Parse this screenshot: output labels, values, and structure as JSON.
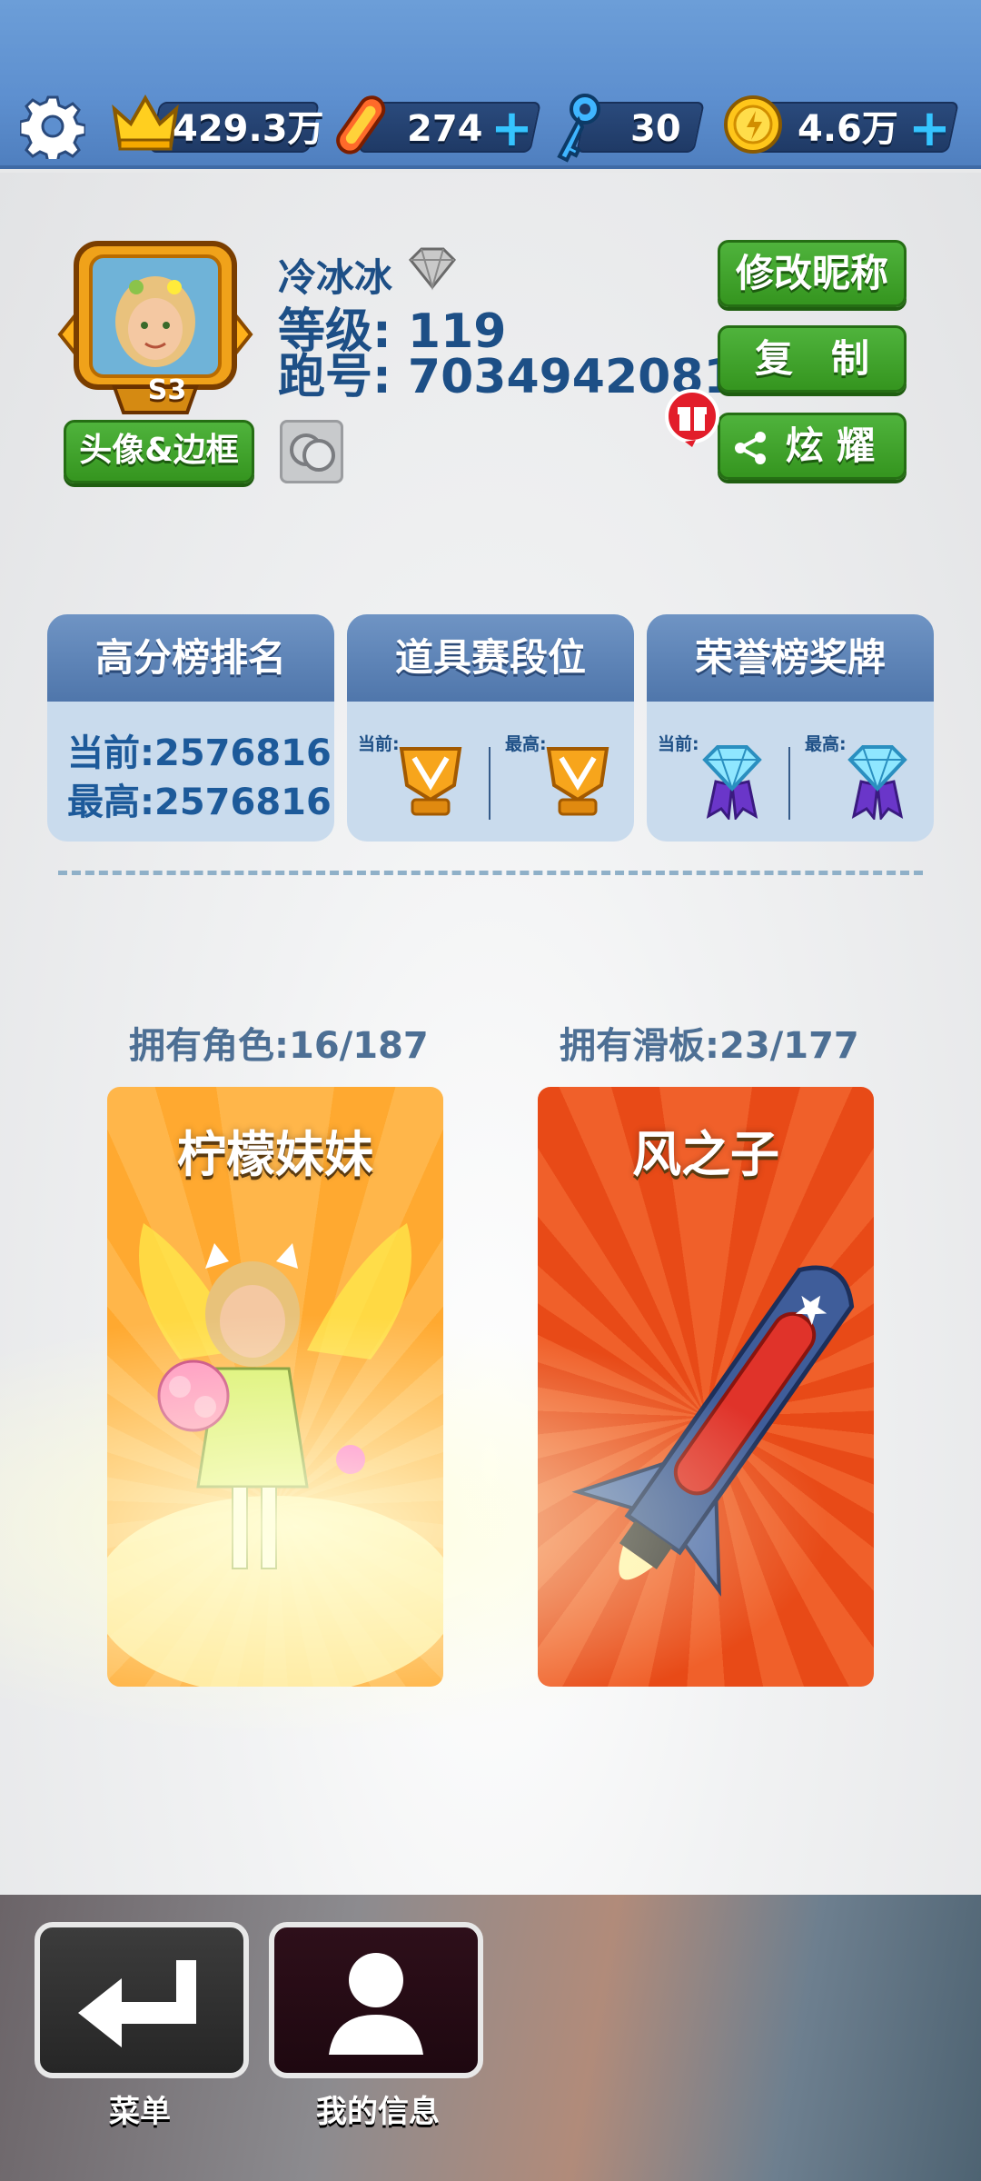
{
  "topbar": {
    "crown_value": "429.3万",
    "boards_value": "274",
    "keys_value": "30",
    "coins_value": "4.6万",
    "plus": "+"
  },
  "profile": {
    "name": "冷冰冰",
    "level_line": "等级: 119",
    "runid_line": "跑号: 7034942081",
    "avatar_badge": "S3",
    "avatar_button": "头像&边框",
    "rename_button": "修改昵称",
    "copy_button": "复　制",
    "share_button": "炫 耀"
  },
  "cards": {
    "score_title": "高分榜排名",
    "score_current": "当前:2576816",
    "score_best": "最高:2576816",
    "tier_title": "道具赛段位",
    "honor_title": "荣誉榜奖牌",
    "current_small": "当前:",
    "best_small": "最高:"
  },
  "collection": {
    "chars_owned": "拥有角色:16/187",
    "boards_owned": "拥有滑板:23/177",
    "char_name": "柠檬妹妹",
    "board_name": "风之子"
  },
  "nav": {
    "menu_label": "菜单",
    "info_label": "我的信息"
  },
  "colors": {
    "topbar": "#5d8fcf",
    "green_button": "#3fa42c",
    "card_head": "#5f85b8",
    "accent_blue": "#1d5a9a"
  }
}
